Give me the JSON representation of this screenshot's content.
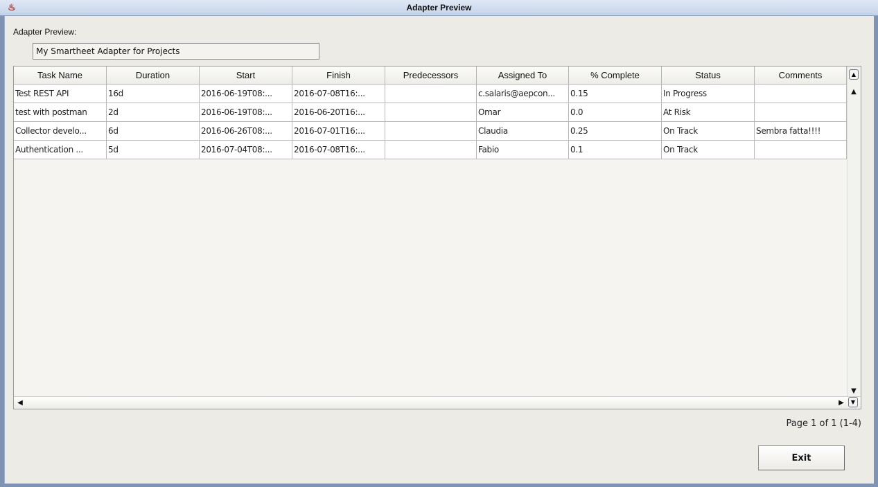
{
  "window": {
    "title": "Adapter Preview"
  },
  "form": {
    "label": "Adapter Preview:",
    "name_value": "My Smartheet Adapter for Projects"
  },
  "table": {
    "columns": [
      "Task Name",
      "Duration",
      "Start",
      "Finish",
      "Predecessors",
      "Assigned To",
      "% Complete",
      "Status",
      "Comments"
    ],
    "rows": [
      [
        "Test REST API",
        "16d",
        "2016-06-19T08:...",
        "2016-07-08T16:...",
        "",
        "c.salaris@aepcon...",
        "0.15",
        "In Progress",
        ""
      ],
      [
        "test with postman",
        "2d",
        "2016-06-19T08:...",
        "2016-06-20T16:...",
        "",
        "Omar",
        "0.0",
        "At Risk",
        ""
      ],
      [
        "Collector develo...",
        "6d",
        "2016-06-26T08:...",
        "2016-07-01T16:...",
        "",
        "Claudia",
        "0.25",
        "On Track",
        "Sembra fatta!!!!"
      ],
      [
        "Authentication ...",
        "5d",
        "2016-07-04T08:...",
        "2016-07-08T16:...",
        "",
        "Fabio",
        "0.1",
        "On Track",
        ""
      ]
    ]
  },
  "pagination": "Page 1 of 1 (1-4)",
  "buttons": {
    "exit": "Exit"
  }
}
